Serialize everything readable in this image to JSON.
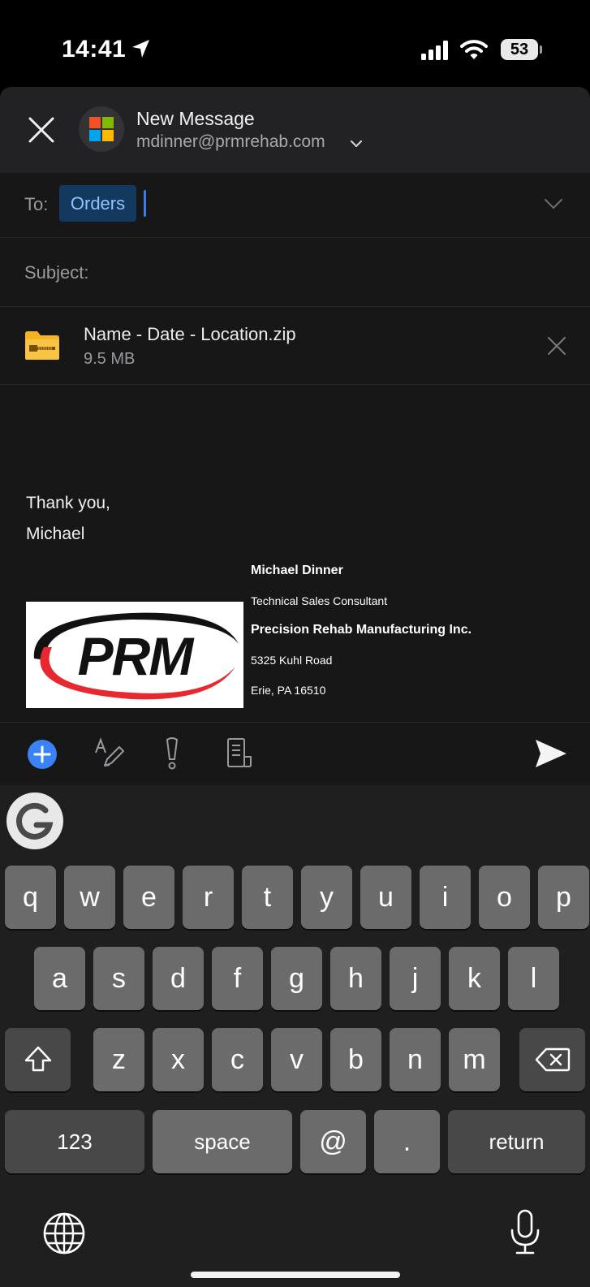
{
  "status_bar": {
    "time": "14:41",
    "battery": "53"
  },
  "header": {
    "title": "New Message",
    "account": "mdinner@prmrehab.com"
  },
  "to": {
    "label": "To:",
    "recipient": "Orders"
  },
  "subject": {
    "label": "Subject:"
  },
  "attachment": {
    "name": "Name - Date - Location.zip",
    "size": "9.5 MB"
  },
  "body": {
    "closing": "Thank you,",
    "sender": "Michael"
  },
  "signature": {
    "name": "Michael Dinner",
    "title": "Technical Sales Consultant",
    "company": "Precision Rehab Manufacturing Inc.",
    "street": "5325 Kuhl Road",
    "city": "Erie, PA 16510",
    "logo_text": "PRM"
  },
  "keyboard": {
    "row1": [
      "q",
      "w",
      "e",
      "r",
      "t",
      "y",
      "u",
      "i",
      "o",
      "p"
    ],
    "row2": [
      "a",
      "s",
      "d",
      "f",
      "g",
      "h",
      "j",
      "k",
      "l"
    ],
    "row3": [
      "z",
      "x",
      "c",
      "v",
      "b",
      "n",
      "m"
    ],
    "numbers_key": "123",
    "space_key": "space",
    "at_key": "@",
    "period_key": ".",
    "return_key": "return"
  },
  "colors": {
    "accent": "#3a82f7",
    "chip_bg": "#133a5e",
    "chip_text": "#8fc2ff",
    "logo_red": "#e8272f"
  }
}
